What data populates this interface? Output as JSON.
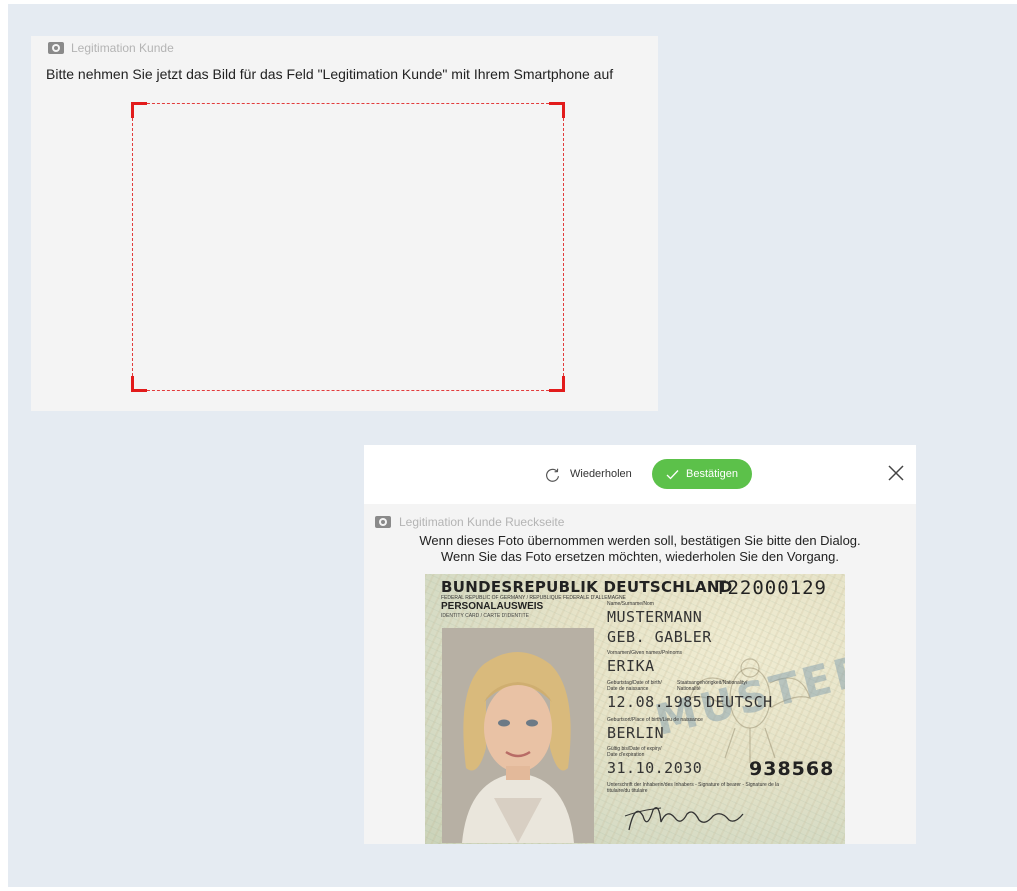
{
  "capture": {
    "header_label": "Legitimation Kunde",
    "header_icon": "camera-icon",
    "instruction": "Bitte nehmen Sie jetzt das Bild für das Feld \"Legitimation Kunde\" mit Ihrem Smartphone auf",
    "frame_color": "#e21b1b"
  },
  "dialog": {
    "retry_label": "Wiederholen",
    "retry_icon": "refresh-icon",
    "confirm_label": "Bestätigen",
    "confirm_icon": "check-icon",
    "confirm_color": "#5cc14a",
    "close_icon": "close-icon",
    "header_label": "Legitimation Kunde Rueckseite",
    "header_icon": "camera-icon",
    "message_line1": "Wenn dieses Foto übernommen werden soll, bestätigen Sie bitte den Dialog.",
    "message_line2": "Wenn Sie das Foto ersetzen möchten, wiederholen Sie den Vorgang."
  },
  "id_card": {
    "country_title": "BUNDESREPUBLIK DEUTSCHLAND",
    "country_sub": "FEDERAL REPUBLIC OF GERMANY / REPUBLIQUE FEDERALE D'ALLEMAGNE",
    "doc_type": "PERSONALAUSWEIS",
    "doc_type_sub": "IDENTITY CARD / CARTE D'IDENTITE",
    "doc_number": "T22000129",
    "name_label": "Name/Surname/Nom",
    "surname": "MUSTERMANN",
    "birth_name": "GEB. GABLER",
    "given_label": "Vornamen/Given names/Prénoms",
    "given_names": "ERIKA",
    "dob_label": "Geburtstag/Date of birth/ Date de naissance",
    "nationality_label": "Staatsangehörigkeit/Nationality/ Nationalité",
    "dob": "12.08.1985",
    "nationality": "DEUTSCH",
    "pob_label": "Geburtsort/Place of birth/Lieu de naissance",
    "pob": "BERLIN",
    "expiry_label": "Gültig bis/Date of expiry/ Date d'expiration",
    "expiry": "31.10.2030",
    "can_number": "938568",
    "signature_label": "Unterschrift der Inhaberin/des Inhabers - Signature of bearer - Signature de la titulaire/du titulaire",
    "watermark": "MUSTER"
  }
}
